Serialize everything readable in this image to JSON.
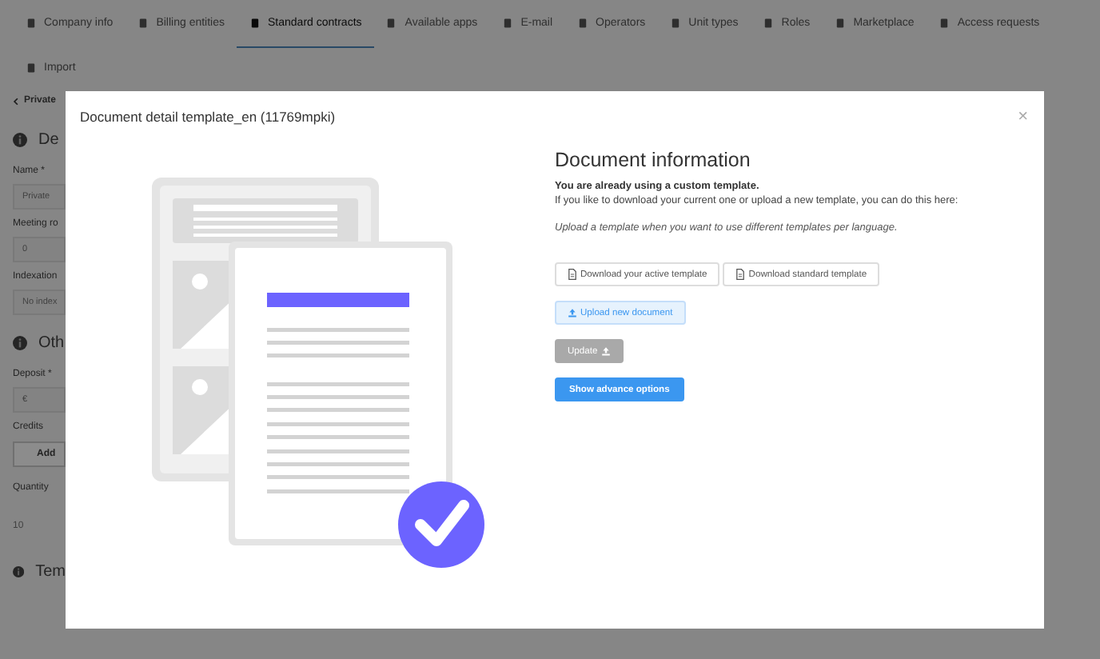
{
  "tabs": [
    {
      "label": "Company info",
      "selected": false
    },
    {
      "label": "Billing entities",
      "selected": false
    },
    {
      "label": "Standard contracts",
      "selected": true
    },
    {
      "label": "Available apps",
      "selected": false
    },
    {
      "label": "E-mail",
      "selected": false
    },
    {
      "label": "Operators",
      "selected": false
    },
    {
      "label": "Unit types",
      "selected": false
    },
    {
      "label": "Roles",
      "selected": false
    },
    {
      "label": "Marketplace",
      "selected": false
    },
    {
      "label": "Access requests",
      "selected": false
    }
  ],
  "import_link": "Import",
  "page_items": [
    {
      "kind": "back",
      "text": "Private"
    },
    {
      "kind": "section",
      "text": "De"
    },
    {
      "kind": "label",
      "text": "Name *"
    },
    {
      "kind": "input",
      "text": "Private"
    },
    {
      "kind": "label",
      "text": "Meeting ro"
    },
    {
      "kind": "input",
      "text": "0"
    },
    {
      "kind": "label",
      "text": "Indexation"
    },
    {
      "kind": "input",
      "text": "No index"
    },
    {
      "kind": "section",
      "text": "Oth"
    },
    {
      "kind": "label",
      "text": "Deposit *"
    },
    {
      "kind": "input",
      "text": "€"
    },
    {
      "kind": "label",
      "text": "Credits"
    },
    {
      "kind": "button",
      "text": "Add"
    },
    {
      "kind": "header",
      "text": "Quantity"
    },
    {
      "kind": "cell",
      "text": "10"
    },
    {
      "kind": "section",
      "text": "Tem"
    }
  ],
  "modal": {
    "title": "Document detail template_en (11769mpki)",
    "close": "×",
    "heading": "Document information",
    "notice": "You are already using a custom template.",
    "text": "If you like to download your current one or upload a new template, you can do this here:",
    "hint": "Upload a template when you want to use different templates per language.",
    "button_rows": [
      [
        {
          "label": "Download your active template",
          "kind": "outline"
        },
        {
          "label": "Download standard template",
          "kind": "outline"
        }
      ],
      [
        {
          "label": "Upload new document",
          "kind": "light"
        }
      ],
      [
        {
          "label": "Update",
          "kind": "disabled"
        }
      ],
      [
        {
          "label": "Show advance options",
          "kind": "primary"
        }
      ]
    ]
  }
}
